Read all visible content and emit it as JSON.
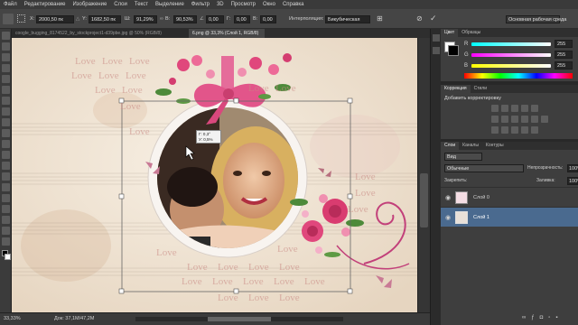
{
  "menu": [
    "Файл",
    "Редактирование",
    "Изображение",
    "Слои",
    "Текст",
    "Выделение",
    "Фильтр",
    "3D",
    "Просмотр",
    "Окно",
    "Справка"
  ],
  "options": {
    "x_label": "X:",
    "x_value": "2000,50 пк",
    "y_label": "Y:",
    "y_value": "1682,50 пк",
    "w_label": "Ш:",
    "w_value": "91,29%",
    "h_label": "В:",
    "h_value": "90,53%",
    "angle_value": "0,00",
    "hskew_label": "Г:",
    "hskew_value": "0,00",
    "vskew_label": "В:",
    "vskew_value": "0,00",
    "interp_label": "Интерполяция:",
    "interp_value": "Бикубическая",
    "workspace": "Основная рабочая среда"
  },
  "tabs": [
    "coogle_bugging_8174522_by_stockproject1-d39pbe.jpg @ 50% (RGB/8)",
    "6.png @ 33,3% (Слой 1, RGB/8)"
  ],
  "canvas": {
    "love": "Love",
    "transform_readout": [
      "Г: 0,3°",
      "У: 0,5%"
    ]
  },
  "status": {
    "zoom": "33,33%",
    "doc": "Док: 37,1М/47,2М"
  },
  "color_panel": {
    "tabs": [
      "Цвет",
      "Образцы"
    ],
    "r": "R",
    "g": "G",
    "b": "B",
    "r_value": "255",
    "g_value": "255",
    "b_value": "255"
  },
  "adjust_panel": {
    "tabs": [
      "Коррекция",
      "Стили"
    ],
    "title": "Добавить корректировку"
  },
  "layers_panel": {
    "tabs": [
      "Слои",
      "Каналы",
      "Контуры"
    ],
    "kind": "Вид",
    "blend": "Обычные",
    "opacity_label": "Непрозрачность:",
    "opacity_value": "100%",
    "lock_label": "Закрепить:",
    "fill_label": "Заливка:",
    "fill_value": "100%",
    "layers": [
      {
        "name": "Слой 0"
      },
      {
        "name": "Слой 1"
      }
    ]
  }
}
